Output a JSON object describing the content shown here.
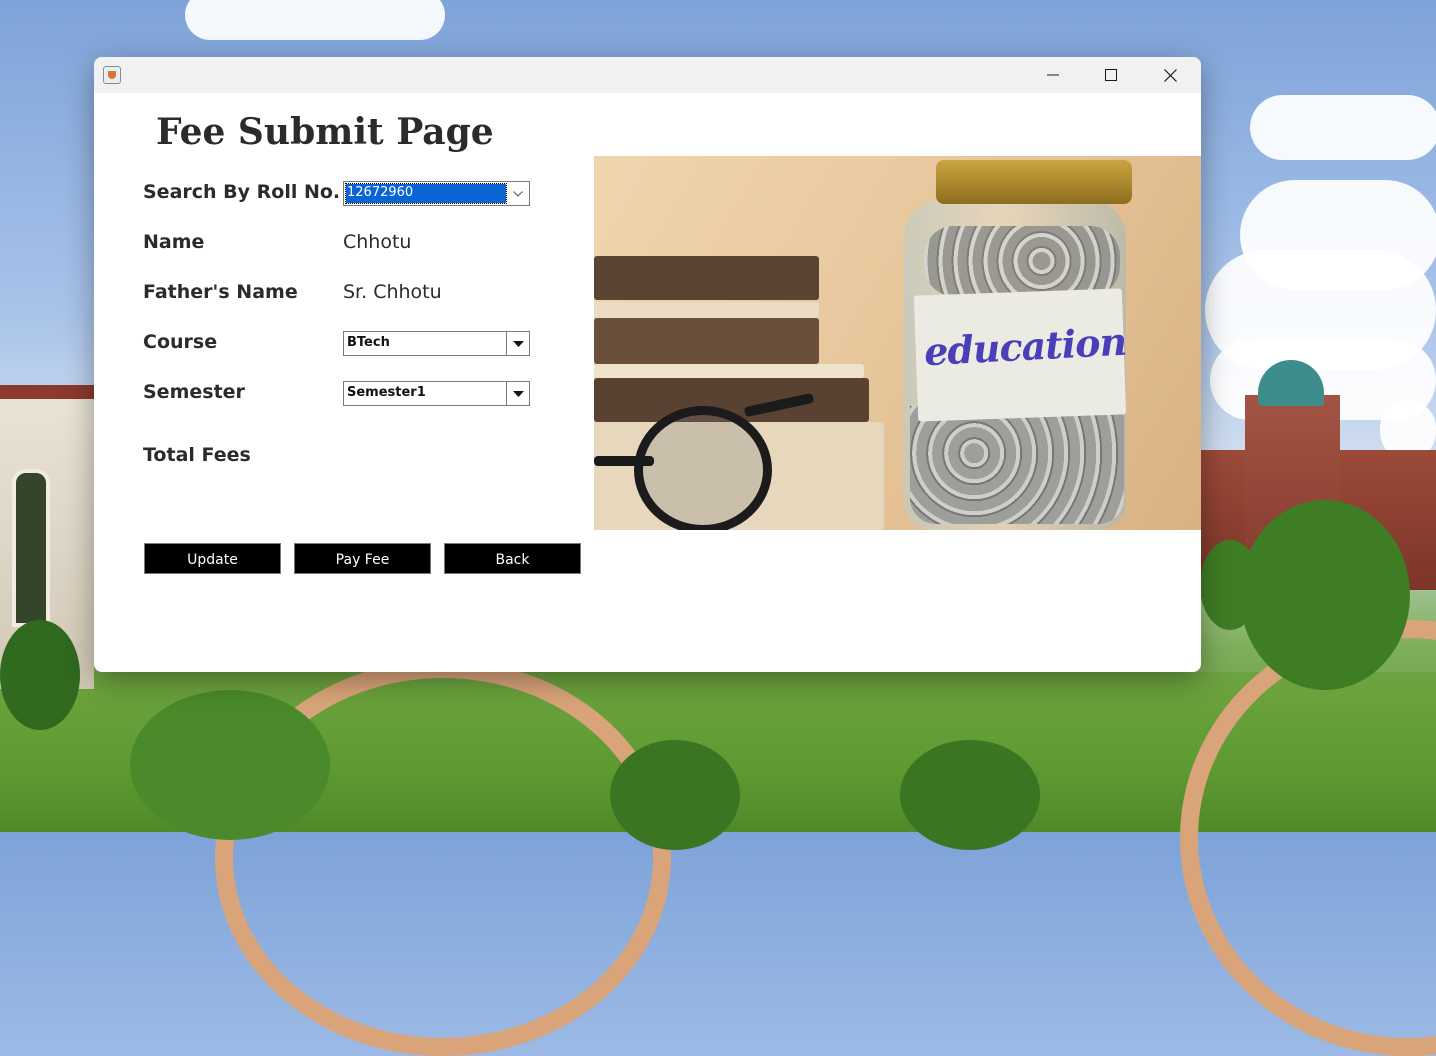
{
  "window": {
    "title": "",
    "controls": {
      "minimize": "minimize",
      "maximize": "maximize",
      "close": "close"
    }
  },
  "page": {
    "title": "Fee Submit Page"
  },
  "form": {
    "roll_label": "Search By Roll No.",
    "roll_value": "12672960",
    "name_label": "Name",
    "name_value": "Chhotu",
    "father_label": "Father's Name",
    "father_value": "Sr. Chhotu",
    "course_label": "Course",
    "course_value": "BTech",
    "semester_label": "Semester",
    "semester_value": "Semester1",
    "total_fees_label": "Total Fees",
    "total_fees_value": ""
  },
  "buttons": {
    "update": "Update",
    "pay_fee": "Pay Fee",
    "back": "Back"
  },
  "image": {
    "label_text": "education"
  },
  "icons": {
    "app": "java-app-icon",
    "dropdown": "chevron-down-icon",
    "minimize": "minimize-icon",
    "maximize": "maximize-icon",
    "close": "close-icon"
  },
  "colors": {
    "button_bg": "#000000",
    "button_text": "#ffffff",
    "selection": "#0a64d4"
  }
}
